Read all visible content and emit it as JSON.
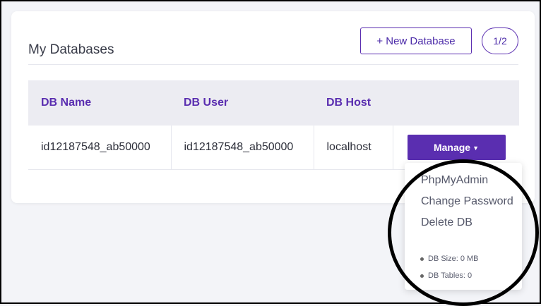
{
  "card": {
    "title": "My Databases",
    "new_database_label": "+ New Database",
    "pagination": "1/2"
  },
  "table": {
    "headers": [
      "DB Name",
      "DB User",
      "DB Host",
      ""
    ],
    "rows": [
      {
        "db_name": "id12187548_ab50000",
        "db_user": "id12187548_ab50000",
        "db_host": "localhost",
        "action_label": "Manage"
      }
    ]
  },
  "manage_menu": {
    "items": [
      "PhpMyAdmin",
      "Change Password",
      "Delete DB"
    ],
    "stats": [
      "DB Size: 0 MB",
      "DB Tables: 0"
    ]
  },
  "colors": {
    "accent": "#5a2eb0",
    "background": "#f3f4f8",
    "header_bg": "#ececf2"
  }
}
